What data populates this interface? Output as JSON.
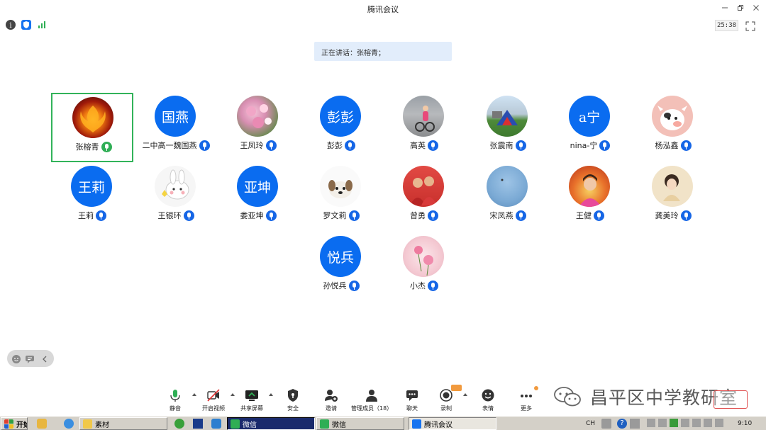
{
  "window": {
    "title": "腾讯会议"
  },
  "status": {
    "timer": "25:38"
  },
  "speaking": {
    "text": "正在讲话：张榕青；"
  },
  "participants": [
    {
      "name": "张榕青",
      "avatar_text": "",
      "avatar_kind": "photo",
      "mic": "green"
    },
    {
      "name": "二中高一魏国燕",
      "avatar_text": "国燕",
      "avatar_kind": "blue",
      "mic": "blue"
    },
    {
      "name": "王凤玲",
      "avatar_text": "",
      "avatar_kind": "photo",
      "mic": "blue"
    },
    {
      "name": "彭彭",
      "avatar_text": "彭彭",
      "avatar_kind": "blue",
      "mic": "blue"
    },
    {
      "name": "高英",
      "avatar_text": "",
      "avatar_kind": "photo",
      "mic": "blue"
    },
    {
      "name": "张震南",
      "avatar_text": "",
      "avatar_kind": "photo",
      "mic": "blue"
    },
    {
      "name": "nina-宁",
      "avatar_text": "a宁",
      "avatar_kind": "blue",
      "mic": "blue"
    },
    {
      "name": "杨泓鑫",
      "avatar_text": "",
      "avatar_kind": "photo",
      "mic": "blue"
    },
    {
      "name": "王莉",
      "avatar_text": "王莉",
      "avatar_kind": "blue",
      "mic": "blue"
    },
    {
      "name": "王银环",
      "avatar_text": "",
      "avatar_kind": "photo",
      "mic": "blue"
    },
    {
      "name": "娄亚坤",
      "avatar_text": "亚坤",
      "avatar_kind": "blue",
      "mic": "blue"
    },
    {
      "name": "罗文莉",
      "avatar_text": "",
      "avatar_kind": "photo",
      "mic": "blue"
    },
    {
      "name": "曾勇",
      "avatar_text": "",
      "avatar_kind": "photo",
      "mic": "blue"
    },
    {
      "name": "宋凤燕",
      "avatar_text": "",
      "avatar_kind": "photo",
      "mic": "blue"
    },
    {
      "name": "王健",
      "avatar_text": "",
      "avatar_kind": "photo",
      "mic": "blue"
    },
    {
      "name": "龚美玲",
      "avatar_text": "",
      "avatar_kind": "photo",
      "mic": "blue"
    },
    {
      "name": "孙悦兵",
      "avatar_text": "悦兵",
      "avatar_kind": "blue",
      "mic": "blue"
    },
    {
      "name": "小杰",
      "avatar_text": "",
      "avatar_kind": "photo",
      "mic": "blue"
    }
  ],
  "toolbar": {
    "mute": "静音",
    "video": "开启视频",
    "share": "共享屏幕",
    "security": "安全",
    "invite": "邀请",
    "members": "管理成员（18）",
    "chat": "聊天",
    "record": "录制",
    "emoji": "表情",
    "more": "更多"
  },
  "watermark": {
    "text": "昌平区中学教研室"
  },
  "taskbar": {
    "start": "开始",
    "items": [
      "素材",
      "微信",
      "微信",
      "腾讯会议"
    ],
    "ime": "CH",
    "clock": "9:10"
  },
  "colors": {
    "accent": "#0a6cf0",
    "active_border": "#32b35a",
    "mic": "#1666e6",
    "mic_active": "#2fae55"
  }
}
